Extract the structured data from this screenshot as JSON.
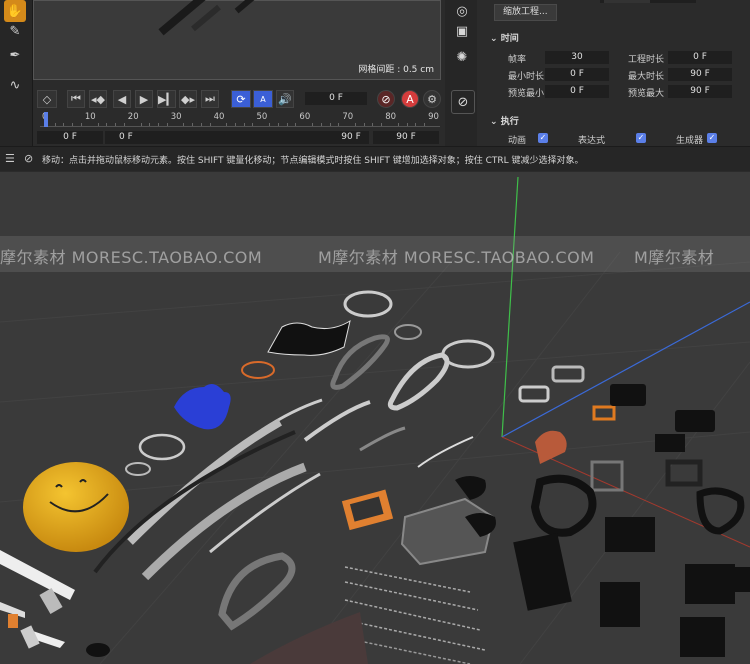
{
  "timeline": {
    "grid_spacing": "网格间距 : 0.5 cm",
    "current_frame": "0 F",
    "ticks": [
      "0",
      "10",
      "20",
      "30",
      "40",
      "50",
      "60",
      "70",
      "80",
      "90"
    ],
    "range": {
      "start_a": "0 F",
      "start_b": "0 F",
      "end_a": "90 F",
      "end_b": "90 F"
    },
    "record_label": "A",
    "keys_label": "A"
  },
  "properties": {
    "zoom_button": "缩放工程...",
    "time_section": "时间",
    "fps_label": "帧率",
    "fps_value": "30",
    "proj_len_label": "工程时长",
    "proj_len_value": "0 F",
    "min_len_label": "最小时长",
    "min_len_value": "0 F",
    "max_len_label": "最大时长",
    "max_len_value": "90 F",
    "preview_min_label": "预览最小",
    "preview_min_value": "0 F",
    "preview_max_label": "预览最大",
    "preview_max_value": "90 F",
    "exec_section": "执行",
    "anim_label": "动画",
    "expr_label": "表达式",
    "gen_label": "生成器"
  },
  "status": {
    "text": "移动：点击并拖动鼠标移动元素。按住 SHIFT 键量化移动；节点编辑模式时按住 SHIFT 键增加选择对象；按住 CTRL 键减少选择对象。"
  },
  "watermark": {
    "left": "摩尔素材  MORESC.TAOBAO.COM",
    "mid": "M摩尔素材  MORESC.TAOBAO.COM",
    "right": "M摩尔素材"
  },
  "colors": {
    "accent": "#d48a1a",
    "blue": "#3b5fd6",
    "axis_green": "#3fbf4a",
    "axis_blue": "#3a6ad8",
    "axis_red": "#c0392b"
  }
}
